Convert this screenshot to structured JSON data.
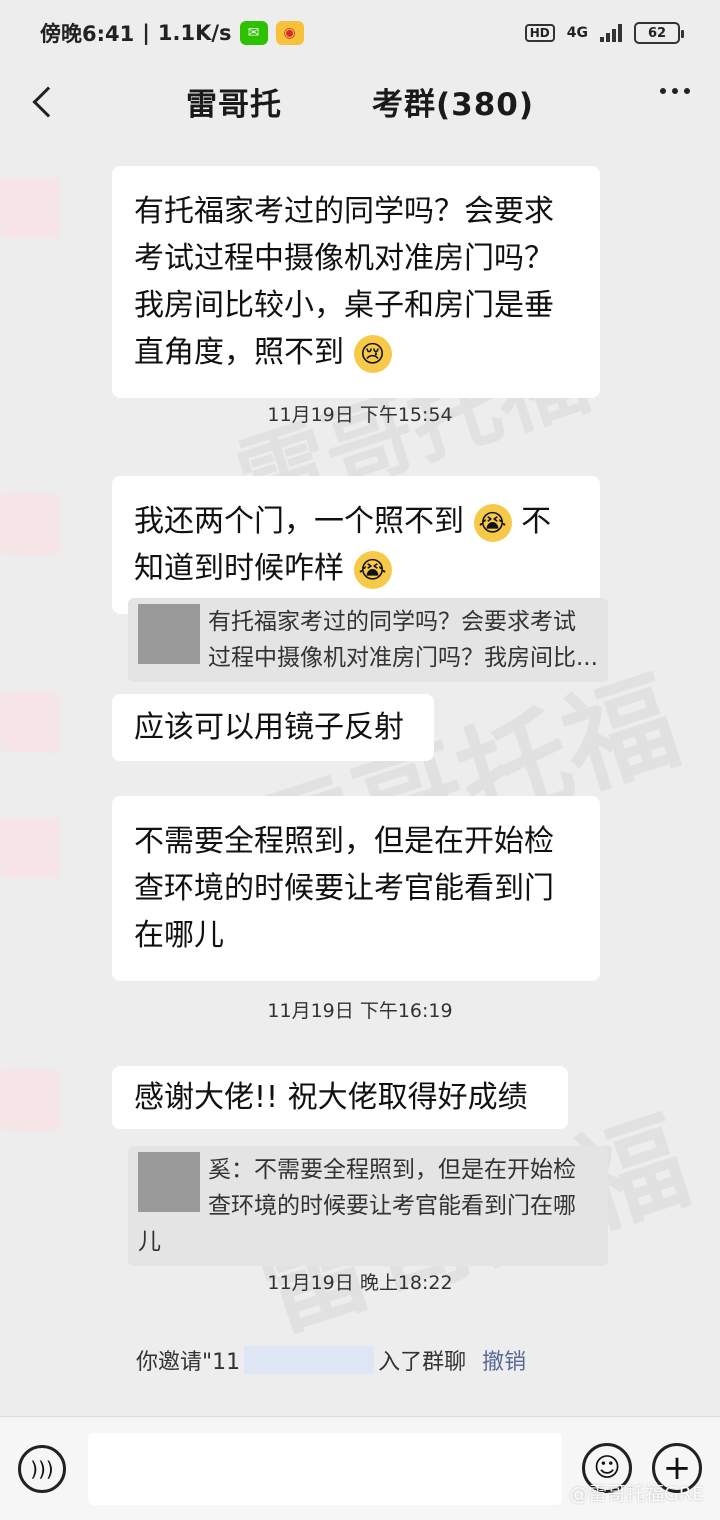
{
  "status_bar": {
    "time": "傍晚6:41",
    "net_speed": "1.1K/s",
    "network_type": "4G",
    "hd_label": "HD",
    "battery": "62"
  },
  "header": {
    "title_prefix": "雷哥托",
    "title_suffix": "考群(380)"
  },
  "watermarks": [
    "雷哥托福",
    "雷哥托福",
    "雷哥托福"
  ],
  "messages": [
    {
      "text": "有托福家考过的同学吗？会要求考试过程中摄像机对准房门吗？我房间比较小，桌子和房门是垂直角度，照不到",
      "emoji": "😢"
    },
    {
      "text": "我还两个门，一个照不到",
      "emoji": "😭",
      "text2": "不知道到时候咋样",
      "emoji2": "😭"
    },
    {
      "text": "应该可以用镜子反射"
    },
    {
      "text": "不需要全程照到，但是在开始检查环境的时候要让考官能看到门在哪儿"
    },
    {
      "text": "感谢大佬!! 祝大佬取得好成绩"
    }
  ],
  "quotes": [
    {
      "text": "有托福家考过的同学吗？会要求考试过程中摄像机对准房门吗？我房间比..."
    },
    {
      "text": "奚：不需要全程照到，但是在开始检查环境的时候要让考官能看到门在哪儿"
    }
  ],
  "timestamps": [
    "11月19日 下午15:54",
    "11月19日 下午16:19",
    "11月19日 晚上18:22"
  ],
  "system_message": {
    "prefix": "你邀请\"11",
    "suffix": "入了群聊",
    "action": "撤销"
  },
  "input": {
    "placeholder": ""
  },
  "footer_watermark": "@雷哥托福GRE"
}
